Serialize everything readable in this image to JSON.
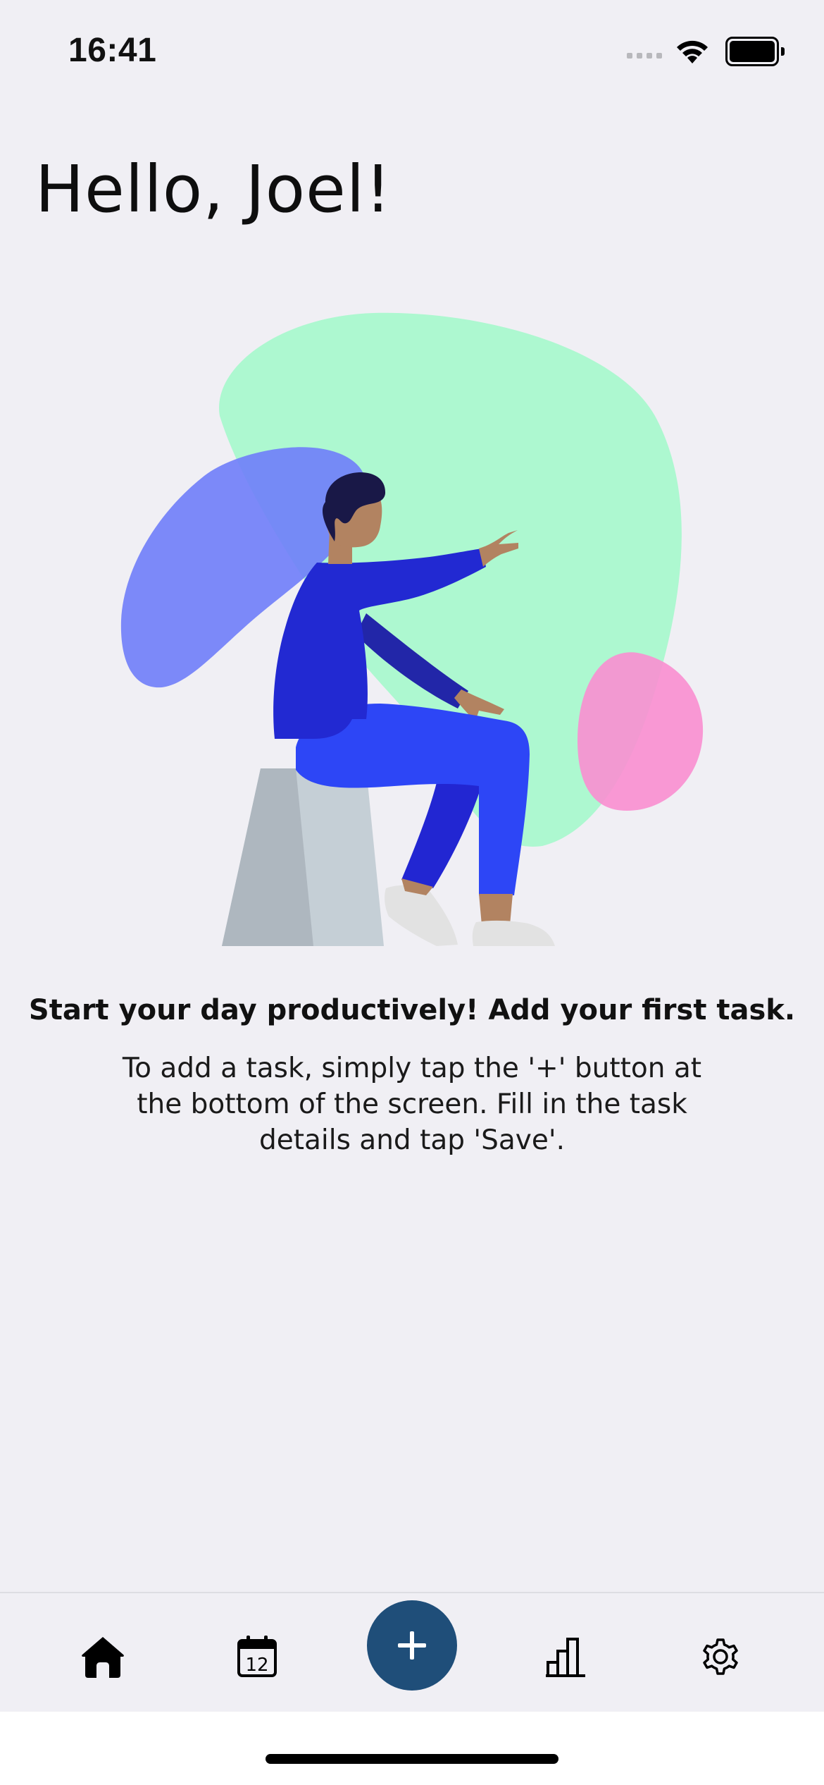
{
  "status_bar": {
    "time": "16:41",
    "signal_icon": "cellular-signal-icon",
    "wifi_icon": "wifi-icon",
    "battery_icon": "battery-icon",
    "battery_level": 1.0
  },
  "header": {
    "greeting": "Hello, Joel!"
  },
  "empty_state": {
    "illustration": "person-sitting-pointing-illustration",
    "title": "Start your day productively! Add your first task.",
    "body_lines": [
      "To add a task, simply tap the '+' button at",
      "the bottom of the screen. Fill in the task",
      "details and tap 'Save'."
    ]
  },
  "tab_bar": {
    "items": [
      {
        "name": "home",
        "icon": "home-icon",
        "selected": true
      },
      {
        "name": "calendar",
        "icon": "calendar-icon",
        "calendar_day": "12"
      },
      {
        "name": "add",
        "icon": "plus-icon",
        "label": "+"
      },
      {
        "name": "statistics",
        "icon": "bar-chart-icon"
      },
      {
        "name": "settings",
        "icon": "gear-icon"
      }
    ],
    "accent_color": "#1f4e79"
  },
  "colors": {
    "background": "#f0eff4",
    "blob_green": "#adf8d0",
    "blob_blue": "#7b88fb",
    "blob_pink": "#fa99d4",
    "shirt": "#2229d2",
    "pants": "#2d46f6"
  }
}
